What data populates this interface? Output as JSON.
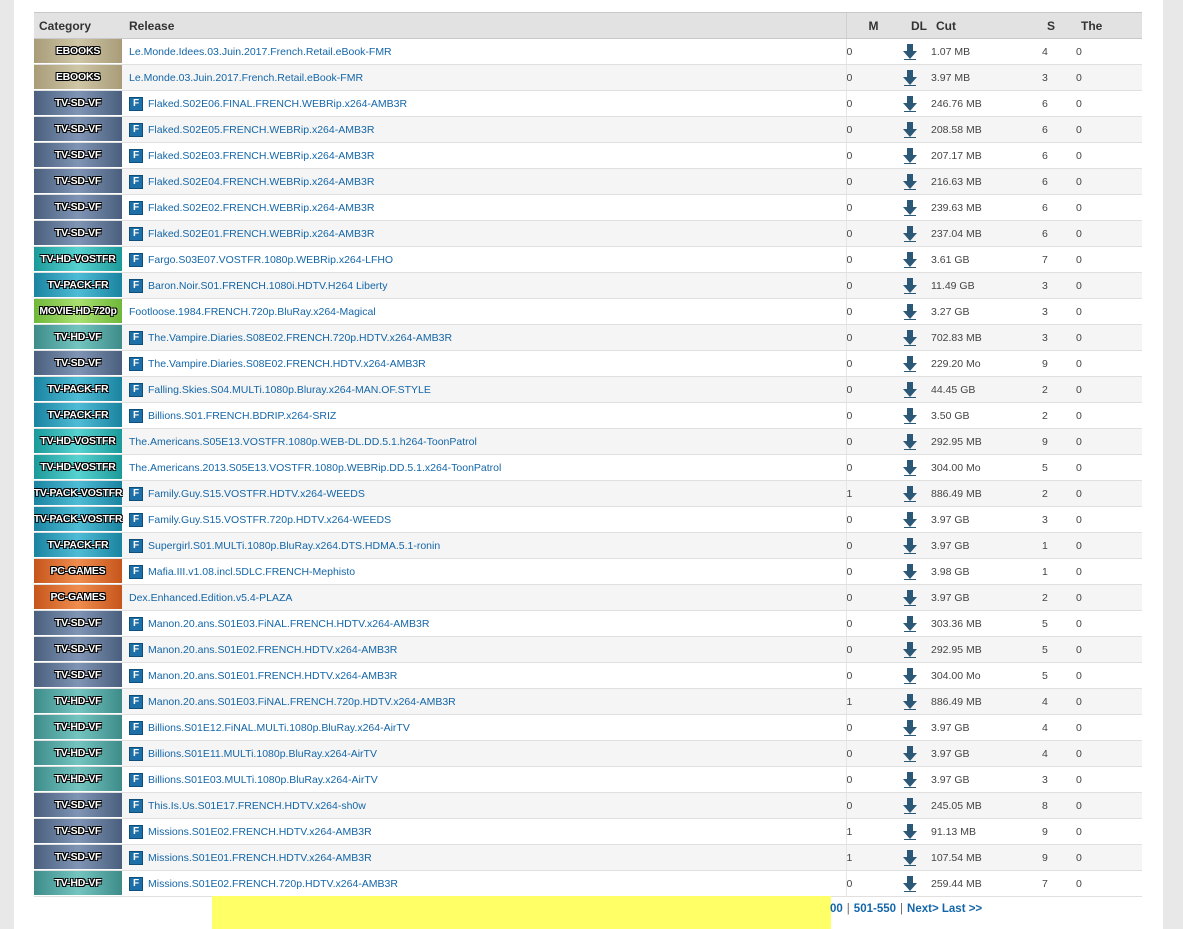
{
  "table": {
    "headers": {
      "category": "Category",
      "release": "Release",
      "m": "M",
      "dl": "DL",
      "cut": "Cut",
      "s": "S",
      "the": "The"
    },
    "rows": [
      {
        "category": "EBOOKS",
        "cat_class": "cat-ebooks",
        "icon": false,
        "release": "Le.Monde.Idees.03.Juin.2017.French.Retail.eBook-FMR",
        "m": "0",
        "size": "1.07 MB",
        "s": "4",
        "l": "0"
      },
      {
        "category": "EBOOKS",
        "cat_class": "cat-ebooks",
        "icon": false,
        "release": "Le.Monde.03.Juin.2017.French.Retail.eBook-FMR",
        "m": "0",
        "size": "3.97 MB",
        "s": "3",
        "l": "0"
      },
      {
        "category": "TV-SD-VF",
        "cat_class": "cat-sdvf",
        "icon": true,
        "release": "Flaked.S02E06.FINAL.FRENCH.WEBRip.x264-AMB3R",
        "m": "0",
        "size": "246.76 MB",
        "s": "6",
        "l": "0"
      },
      {
        "category": "TV-SD-VF",
        "cat_class": "cat-sdvf",
        "icon": true,
        "release": "Flaked.S02E05.FRENCH.WEBRip.x264-AMB3R",
        "m": "0",
        "size": "208.58 MB",
        "s": "6",
        "l": "0"
      },
      {
        "category": "TV-SD-VF",
        "cat_class": "cat-sdvf",
        "icon": true,
        "release": "Flaked.S02E03.FRENCH.WEBRip.x264-AMB3R",
        "m": "0",
        "size": "207.17 MB",
        "s": "6",
        "l": "0"
      },
      {
        "category": "TV-SD-VF",
        "cat_class": "cat-sdvf",
        "icon": true,
        "release": "Flaked.S02E04.FRENCH.WEBRip.x264-AMB3R",
        "m": "0",
        "size": "216.63 MB",
        "s": "6",
        "l": "0"
      },
      {
        "category": "TV-SD-VF",
        "cat_class": "cat-sdvf",
        "icon": true,
        "release": "Flaked.S02E02.FRENCH.WEBRip.x264-AMB3R",
        "m": "0",
        "size": "239.63 MB",
        "s": "6",
        "l": "0"
      },
      {
        "category": "TV-SD-VF",
        "cat_class": "cat-sdvf",
        "icon": true,
        "release": "Flaked.S02E01.FRENCH.WEBRip.x264-AMB3R",
        "m": "0",
        "size": "237.04 MB",
        "s": "6",
        "l": "0"
      },
      {
        "category": "TV-HD-VOSTFR",
        "cat_class": "cat-hdvostfr",
        "icon": true,
        "release": "Fargo.S03E07.VOSTFR.1080p.WEBRip.x264-LFHO",
        "m": "0",
        "size": "3.61 GB",
        "s": "7",
        "l": "0"
      },
      {
        "category": "TV-PACK-FR",
        "cat_class": "cat-pack",
        "icon": true,
        "release": "Baron.Noir.S01.FRENCH.1080i.HDTV.H264 Liberty",
        "m": "0",
        "size": "11.49 GB",
        "s": "3",
        "l": "0"
      },
      {
        "category": "MOVIE-HD-720p",
        "cat_class": "cat-movie",
        "icon": false,
        "release": "Footloose.1984.FRENCH.720p.BluRay.x264-Magical",
        "m": "0",
        "size": "3.27 GB",
        "s": "3",
        "l": "0"
      },
      {
        "category": "TV-HD-VF",
        "cat_class": "cat-hdvf",
        "icon": true,
        "release": "The.Vampire.Diaries.S08E02.FRENCH.720p.HDTV.x264-AMB3R",
        "m": "0",
        "size": "702.83 MB",
        "s": "3",
        "l": "0"
      },
      {
        "category": "TV-SD-VF",
        "cat_class": "cat-sdvf",
        "icon": true,
        "release": "The.Vampire.Diaries.S08E02.FRENCH.HDTV.x264-AMB3R",
        "m": "0",
        "size": "229.20 Mo",
        "s": "9",
        "l": "0"
      },
      {
        "category": "TV-PACK-FR",
        "cat_class": "cat-pack",
        "icon": true,
        "release": "Falling.Skies.S04.MULTi.1080p.Bluray.x264-MAN.OF.STYLE",
        "m": "0",
        "size": "44.45 GB",
        "s": "2",
        "l": "0"
      },
      {
        "category": "TV-PACK-FR",
        "cat_class": "cat-pack",
        "icon": true,
        "release": "Billions.S01.FRENCH.BDRIP.x264-SRIZ",
        "m": "0",
        "size": "3.50 GB",
        "s": "2",
        "l": "0"
      },
      {
        "category": "TV-HD-VOSTFR",
        "cat_class": "cat-hdvostfr",
        "icon": false,
        "release": "The.Americans.S05E13.VOSTFR.1080p.WEB-DL.DD.5.1.h264-ToonPatrol",
        "m": "0",
        "size": "292.95 MB",
        "s": "9",
        "l": "0"
      },
      {
        "category": "TV-HD-VOSTFR",
        "cat_class": "cat-hdvostfr",
        "icon": false,
        "release": "The.Americans.2013.S05E13.VOSTFR.1080p.WEBRip.DD.5.1.x264-ToonPatrol",
        "m": "0",
        "size": "304.00 Mo",
        "s": "5",
        "l": "0"
      },
      {
        "category": "TV-PACK-VOSTFR",
        "cat_class": "cat-pack",
        "icon": true,
        "release": "Family.Guy.S15.VOSTFR.HDTV.x264-WEEDS",
        "m": "1",
        "size": "886.49 MB",
        "s": "2",
        "l": "0"
      },
      {
        "category": "TV-PACK-VOSTFR",
        "cat_class": "cat-pack",
        "icon": true,
        "release": "Family.Guy.S15.VOSTFR.720p.HDTV.x264-WEEDS",
        "m": "0",
        "size": "3.97 GB",
        "s": "3",
        "l": "0"
      },
      {
        "category": "TV-PACK-FR",
        "cat_class": "cat-pack",
        "icon": true,
        "release": "Supergirl.S01.MULTi.1080p.BluRay.x264.DTS.HDMA.5.1-ronin",
        "m": "0",
        "size": "3.97 GB",
        "s": "1",
        "l": "0"
      },
      {
        "category": "PC-GAMES",
        "cat_class": "cat-games",
        "icon": true,
        "release": "Mafia.III.v1.08.incl.5DLC.FRENCH-Mephisto",
        "m": "0",
        "size": "3.98 GB",
        "s": "1",
        "l": "0"
      },
      {
        "category": "PC-GAMES",
        "cat_class": "cat-games",
        "icon": false,
        "release": "Dex.Enhanced.Edition.v5.4-PLAZA",
        "m": "0",
        "size": "3.97 GB",
        "s": "2",
        "l": "0"
      },
      {
        "category": "TV-SD-VF",
        "cat_class": "cat-sdvf",
        "icon": true,
        "release": "Manon.20.ans.S01E03.FiNAL.FRENCH.HDTV.x264-AMB3R",
        "m": "0",
        "size": "303.36 MB",
        "s": "5",
        "l": "0"
      },
      {
        "category": "TV-SD-VF",
        "cat_class": "cat-sdvf",
        "icon": true,
        "release": "Manon.20.ans.S01E02.FRENCH.HDTV.x264-AMB3R",
        "m": "0",
        "size": "292.95 MB",
        "s": "5",
        "l": "0"
      },
      {
        "category": "TV-SD-VF",
        "cat_class": "cat-sdvf",
        "icon": true,
        "release": "Manon.20.ans.S01E01.FRENCH.HDTV.x264-AMB3R",
        "m": "0",
        "size": "304.00 Mo",
        "s": "5",
        "l": "0"
      },
      {
        "category": "TV-HD-VF",
        "cat_class": "cat-hdvf",
        "icon": true,
        "release": "Manon.20.ans.S01E03.FiNAL.FRENCH.720p.HDTV.x264-AMB3R",
        "m": "1",
        "size": "886.49 MB",
        "s": "4",
        "l": "0"
      },
      {
        "category": "TV-HD-VF",
        "cat_class": "cat-hdvf",
        "icon": true,
        "release": "Billions.S01E12.FiNAL.MULTi.1080p.BluRay.x264-AirTV",
        "m": "0",
        "size": "3.97 GB",
        "s": "4",
        "l": "0"
      },
      {
        "category": "TV-HD-VF",
        "cat_class": "cat-hdvf",
        "icon": true,
        "release": "Billions.S01E11.MULTi.1080p.BluRay.x264-AirTV",
        "m": "0",
        "size": "3.97 GB",
        "s": "4",
        "l": "0"
      },
      {
        "category": "TV-HD-VF",
        "cat_class": "cat-hdvf",
        "icon": true,
        "release": "Billions.S01E03.MULTi.1080p.BluRay.x264-AirTV",
        "m": "0",
        "size": "3.97 GB",
        "s": "3",
        "l": "0"
      },
      {
        "category": "TV-SD-VF",
        "cat_class": "cat-sdvf",
        "icon": true,
        "release": "This.Is.Us.S01E17.FRENCH.HDTV.x264-sh0w",
        "m": "0",
        "size": "245.05 MB",
        "s": "8",
        "l": "0"
      },
      {
        "category": "TV-SD-VF",
        "cat_class": "cat-sdvf",
        "icon": true,
        "release": "Missions.S01E02.FRENCH.HDTV.x264-AMB3R",
        "m": "1",
        "size": "91.13 MB",
        "s": "9",
        "l": "0"
      },
      {
        "category": "TV-SD-VF",
        "cat_class": "cat-sdvf",
        "icon": true,
        "release": "Missions.S01E01.FRENCH.HDTV.x264-AMB3R",
        "m": "1",
        "size": "107.54 MB",
        "s": "9",
        "l": "0"
      },
      {
        "category": "TV-HD-VF",
        "cat_class": "cat-hdvf",
        "icon": true,
        "release": "Missions.S01E02.FRENCH.720p.HDTV.x264-AMB3R",
        "m": "0",
        "size": "259.44 MB",
        "s": "7",
        "l": "0"
      }
    ]
  },
  "release_icon_letter": "F",
  "pagination": {
    "partial": "00",
    "range": "501-550",
    "sep": "|",
    "next": "Next>",
    "last": "Last >>"
  },
  "colors": {
    "link": "#1466a8",
    "seeders": "#15962a",
    "leechers": "#e01515",
    "highlight": "#ffff66"
  }
}
